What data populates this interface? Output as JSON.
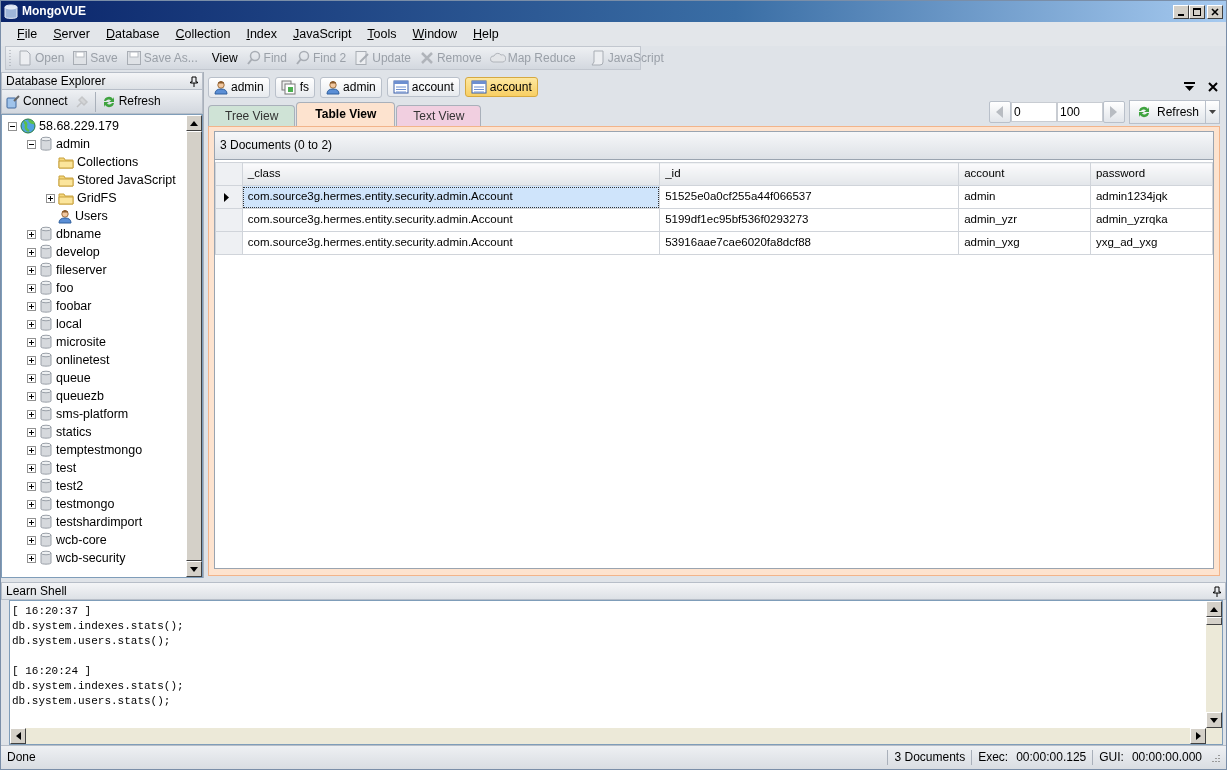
{
  "window": {
    "title": "MongoVUE"
  },
  "menu": [
    {
      "label": "File"
    },
    {
      "label": "Server"
    },
    {
      "label": "Database"
    },
    {
      "label": "Collection"
    },
    {
      "label": "Index"
    },
    {
      "label": "JavaScript"
    },
    {
      "label": "Tools"
    },
    {
      "label": "Window"
    },
    {
      "label": "Help"
    }
  ],
  "toolbar": [
    {
      "kind": "open",
      "label": "Open",
      "disabled": true
    },
    {
      "kind": "save",
      "label": "Save",
      "disabled": true
    },
    {
      "kind": "save",
      "label": "Save As...",
      "disabled": true
    },
    {
      "kind": "separator"
    },
    {
      "kind": "text",
      "label": "View",
      "disabled": false
    },
    {
      "kind": "find",
      "label": "Find",
      "disabled": true
    },
    {
      "kind": "find",
      "label": "Find 2",
      "disabled": true
    },
    {
      "kind": "update",
      "label": "Update",
      "disabled": true
    },
    {
      "kind": "remove",
      "label": "Remove",
      "disabled": true
    },
    {
      "kind": "cloud",
      "label": "Map Reduce",
      "disabled": true
    },
    {
      "kind": "separator"
    },
    {
      "kind": "script",
      "label": "JavaScript",
      "disabled": true
    }
  ],
  "explorer": {
    "title": "Database Explorer",
    "buttons": [
      {
        "kind": "connect",
        "label": "Connect",
        "disabled": false
      },
      {
        "kind": "disconnect",
        "disabled": true
      },
      {
        "kind": "refresh",
        "label": "Refresh",
        "disabled": false
      }
    ],
    "tree": [
      {
        "kind": "server",
        "label": "58.68.229.179",
        "expanded": true,
        "children": [
          {
            "kind": "database",
            "label": "admin",
            "expanded": true,
            "children": [
              {
                "kind": "folder",
                "label": "Collections"
              },
              {
                "kind": "folder",
                "label": "Stored JavaScript"
              },
              {
                "kind": "folder",
                "label": "GridFS",
                "expanded": false
              },
              {
                "kind": "users",
                "label": "Users"
              }
            ]
          },
          {
            "kind": "database",
            "label": "dbname",
            "expanded": false
          },
          {
            "kind": "database",
            "label": "develop",
            "expanded": false
          },
          {
            "kind": "database",
            "label": "fileserver",
            "expanded": false
          },
          {
            "kind": "database",
            "label": "foo",
            "expanded": false
          },
          {
            "kind": "database",
            "label": "foobar",
            "expanded": false
          },
          {
            "kind": "database",
            "label": "local",
            "expanded": false
          },
          {
            "kind": "database",
            "label": "microsite",
            "expanded": false
          },
          {
            "kind": "database",
            "label": "onlinetest",
            "expanded": false
          },
          {
            "kind": "database",
            "label": "queue",
            "expanded": false
          },
          {
            "kind": "database",
            "label": "queuezb",
            "expanded": false
          },
          {
            "kind": "database",
            "label": "sms-platform",
            "expanded": false
          },
          {
            "kind": "database",
            "label": "statics",
            "expanded": false
          },
          {
            "kind": "database",
            "label": "temptestmongo",
            "expanded": false
          },
          {
            "kind": "database",
            "label": "test",
            "expanded": false
          },
          {
            "kind": "database",
            "label": "test2",
            "expanded": false
          },
          {
            "kind": "database",
            "label": "testmongo",
            "expanded": false
          },
          {
            "kind": "database",
            "label": "testshardimport",
            "expanded": false
          },
          {
            "kind": "database",
            "label": "wcb-core",
            "expanded": false
          },
          {
            "kind": "database",
            "label": "wcb-security",
            "expanded": false
          }
        ]
      }
    ]
  },
  "breadcrumbs": [
    {
      "kind": "user",
      "label": "admin",
      "selected": false
    },
    {
      "kind": "gridfs",
      "label": "fs",
      "selected": false
    },
    {
      "kind": "user",
      "label": "admin",
      "selected": false
    },
    {
      "kind": "collection",
      "label": "account",
      "selected": false
    },
    {
      "kind": "collection",
      "label": "account",
      "selected": true
    }
  ],
  "view_tabs": [
    {
      "label": "Tree View",
      "selected": false,
      "color": "#cfe3d6"
    },
    {
      "label": "Table View",
      "selected": true,
      "color": "#fde3cf"
    },
    {
      "label": "Text View",
      "selected": false,
      "color": "#f1cfe0"
    }
  ],
  "pager": {
    "from": "0",
    "to": "100",
    "refresh": "Refresh"
  },
  "grid": {
    "caption": "3 Documents (0 to 2)",
    "columns": [
      "_class",
      "_id",
      "account",
      "password"
    ],
    "rows": [
      {
        "selected": true,
        "cells": [
          "com.source3g.hermes.entity.security.admin.Account",
          "51525e0a0cf255a44f066537",
          "admin",
          "admin1234jqk"
        ]
      },
      {
        "selected": false,
        "cells": [
          "com.source3g.hermes.entity.security.admin.Account",
          "5199df1ec95bf536f0293273",
          "admin_yzr",
          "admin_yzrqka"
        ]
      },
      {
        "selected": false,
        "cells": [
          "com.source3g.hermes.entity.security.admin.Account",
          "53916aae7cae6020fa8dcf88",
          "admin_yxg",
          "yxg_ad_yxg"
        ]
      }
    ]
  },
  "shell": {
    "title": "Learn Shell",
    "entries": [
      {
        "time": "[ 16:20:37 ]",
        "commands": [
          "db.system.indexes.stats();",
          "db.system.users.stats();"
        ]
      },
      {
        "time": "[ 16:20:24 ]",
        "commands": [
          "db.system.indexes.stats();",
          "db.system.users.stats();"
        ]
      }
    ]
  },
  "status_bar": {
    "message": "Done",
    "documents": "3 Documents",
    "exec_label": "Exec:",
    "exec_time": "00:00:00.125",
    "gui_label": "GUI:",
    "gui_time": "00:00:00.000"
  }
}
